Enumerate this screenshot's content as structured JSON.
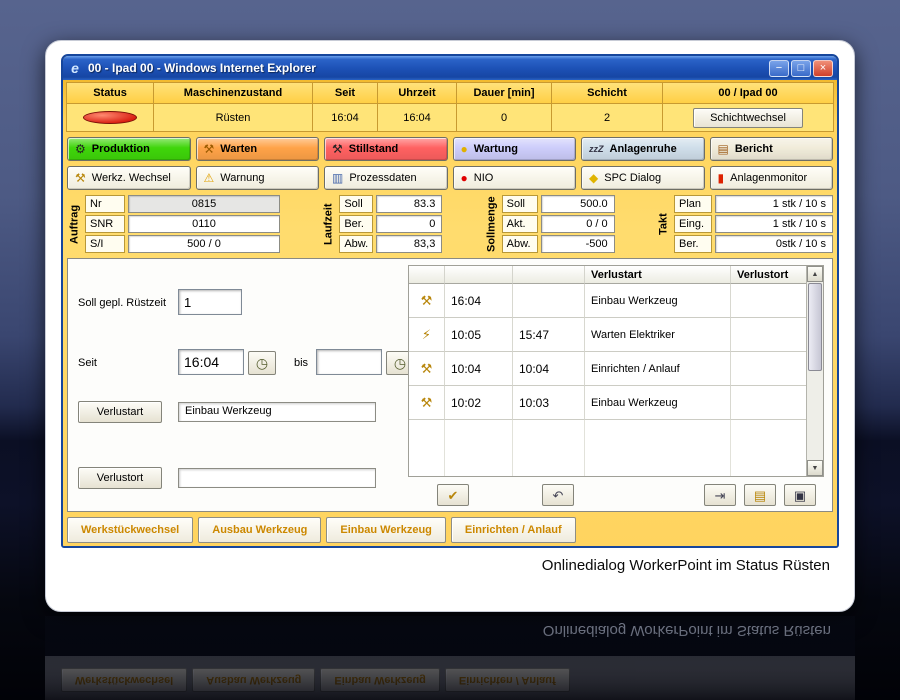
{
  "colors": {
    "titlebar_blue": "#1c50b4",
    "window_gold": "#ffd45f",
    "status_indicator_red": "#d81c10",
    "quick_button_text": "#cc8800"
  },
  "window": {
    "title": "00  - Ipad 00 - Windows Internet Explorer",
    "ie_glyph": "e",
    "controls": {
      "minimize": "−",
      "maximize": "□",
      "close": "×"
    }
  },
  "status_table": {
    "headers": [
      "Status",
      "Maschinenzustand",
      "Seit",
      "Uhrzeit",
      "Dauer [min]",
      "Schicht",
      "00  / Ipad 00"
    ],
    "row": {
      "maschinenzustand": "Rüsten",
      "seit": "16:04",
      "uhrzeit": "16:04",
      "dauer_min": "0",
      "schicht": "2",
      "schichtwechsel_label": "Schichtwechsel"
    }
  },
  "state_buttons": [
    {
      "label": "Produktion",
      "glyph": "⚙",
      "color": "#3fd60a",
      "icon": "gear-icon"
    },
    {
      "label": "Warten",
      "glyph": "⚒",
      "color": "#ffa348",
      "icon": "tools-icon"
    },
    {
      "label": "Stillstand",
      "glyph": "⚒",
      "color": "#ff6161",
      "icon": "hammer-wrench-icon"
    },
    {
      "label": "Wartung",
      "glyph": "●",
      "color": "#cdcdfb",
      "icon": "oil-drop-icon"
    },
    {
      "label": "Anlagenruhe",
      "glyph": "zzZ",
      "color": "#cfdeea",
      "icon": "sleep-icon"
    },
    {
      "label": "Bericht",
      "glyph": "▤",
      "color": "#f1ecda",
      "icon": "report-icon"
    }
  ],
  "function_buttons": [
    {
      "label": "Werkz. Wechsel",
      "glyph": "⚒",
      "icon": "tool-change-icon"
    },
    {
      "label": "Warnung",
      "glyph": "⚠",
      "icon": "warning-icon"
    },
    {
      "label": "Prozessdaten",
      "glyph": "▥",
      "icon": "process-data-icon"
    },
    {
      "label": "NIO",
      "glyph": "●",
      "icon": "nio-icon"
    },
    {
      "label": "SPC Dialog",
      "glyph": "◆",
      "icon": "spc-icon"
    },
    {
      "label": "Anlagenmonitor",
      "glyph": "▮",
      "icon": "thermometer-icon"
    }
  ],
  "panels": {
    "auftrag": {
      "title": "Auftrag",
      "rows": [
        {
          "label": "Nr",
          "value": "0815"
        },
        {
          "label": "SNR",
          "value": "0110"
        },
        {
          "label": "S/I",
          "value": "500 / 0"
        }
      ]
    },
    "laufzeit": {
      "title": "Laufzeit",
      "rows": [
        {
          "label": "Soll",
          "value": "83.3"
        },
        {
          "label": "Ber.",
          "value": "0"
        },
        {
          "label": "Abw.",
          "value": "83,3"
        }
      ]
    },
    "sollmenge": {
      "title": "Sollmenge",
      "rows": [
        {
          "label": "Soll",
          "value": "500.0"
        },
        {
          "label": "Akt.",
          "value": "0 / 0"
        },
        {
          "label": "Abw.",
          "value": "-500"
        }
      ]
    },
    "takt": {
      "title": "Takt",
      "rows": [
        {
          "label": "Plan",
          "value": "1 stk / 10 s"
        },
        {
          "label": "Eing.",
          "value": "1 stk / 10 s"
        },
        {
          "label": "Ber.",
          "value": "0stk / 10 s"
        }
      ]
    }
  },
  "form": {
    "ruestzeit_label": "Soll gepl. Rüstzeit",
    "ruestzeit_value": "1",
    "seit_label": "Seit",
    "seit_value": "16:04",
    "bis_label": "bis",
    "bis_value": "",
    "picker_glyph": "◷",
    "verlustart_button": "Verlustart",
    "verlustart_value": "Einbau Werkzeug",
    "verlustort_button": "Verlustort",
    "verlustort_value": ""
  },
  "log_table": {
    "headers": {
      "verlustart": "Verlustart",
      "verlustort": "Verlustort"
    },
    "rows": [
      {
        "glyph": "⚒",
        "icon": "tools-icon",
        "start": "16:04",
        "end": "",
        "verlustart": "Einbau Werkzeug",
        "verlustort": ""
      },
      {
        "glyph": "⚡",
        "icon": "electrician-icon",
        "start": "10:05",
        "end": "15:47",
        "verlustart": "Warten Elektriker",
        "verlustort": ""
      },
      {
        "glyph": "⚒",
        "icon": "wrench-icon",
        "start": "10:04",
        "end": "10:04",
        "verlustart": "Einrichten / Anlauf",
        "verlustort": ""
      },
      {
        "glyph": "⚒",
        "icon": "wrench-icon",
        "start": "10:02",
        "end": "10:03",
        "verlustart": "Einbau Werkzeug",
        "verlustort": ""
      }
    ]
  },
  "tool_buttons": {
    "confirm_glyph": "✔",
    "undo_glyph": "↶",
    "export_glyph": "⇥",
    "note_glyph": "▤",
    "screen_glyph": "▣"
  },
  "quick_buttons": [
    "Werkstückwechsel",
    "Ausbau Werkzeug",
    "Einbau Werkzeug",
    "Einrichten / Anlauf"
  ],
  "caption": "Onlinedialog WorkerPoint im Status Rüsten"
}
